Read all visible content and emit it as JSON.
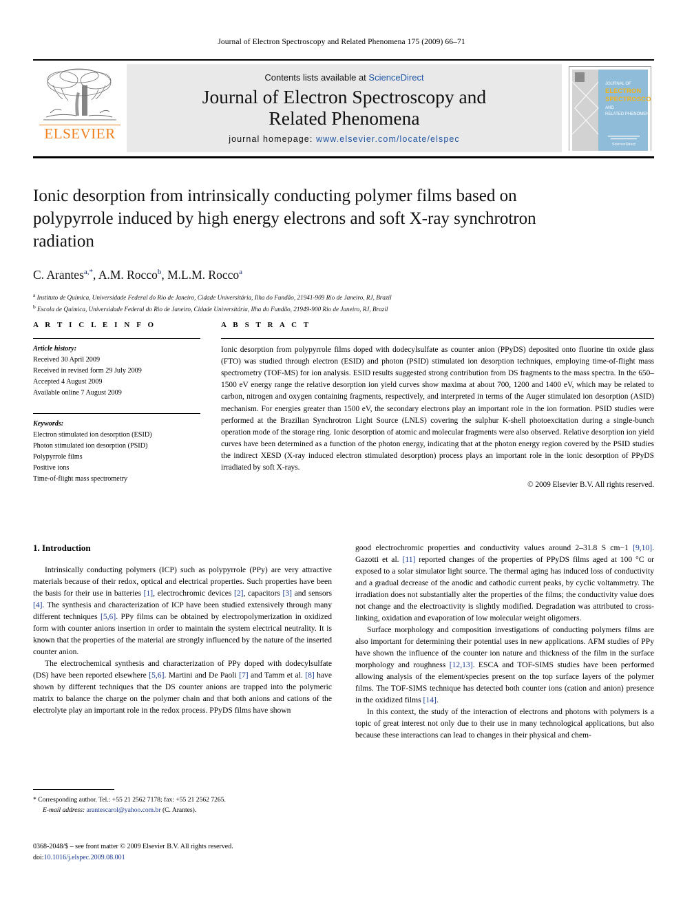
{
  "running_head": "Journal of Electron Spectroscopy and Related Phenomena 175 (2009) 66–71",
  "masthead": {
    "publisher": "ELSEVIER",
    "contents_prefix": "Contents lists available at ",
    "contents_link": "ScienceDirect",
    "journal_title_line1": "Journal of Electron Spectroscopy and",
    "journal_title_line2": "Related Phenomena",
    "homepage_label": "journal homepage:",
    "homepage_url": "www.elsevier.com/locate/elspec",
    "cover": {
      "line1": "JOURNAL OF",
      "line2": "ELECTRON",
      "line3": "SPECTROSCOPY",
      "line4": "AND",
      "line5": "RELATED PHENOMENA",
      "footer": "ScienceDirect",
      "accent_color": "#8fbcd9",
      "text_color": "#f0b41e"
    }
  },
  "article": {
    "title": "Ionic desorption from intrinsically conducting polymer films based on polypyrrole induced by high energy electrons and soft X-ray synchrotron radiation",
    "authors_html": "C. Arantes<sup>a,*</sup>, A.M. Rocco<sup>b</sup>, M.L.M. Rocco<sup>a</sup>",
    "affiliation_a": "Instituto de Química, Universidade Federal do Rio de Janeiro, Cidade Universitária, Ilha do Fundão, 21941-909 Rio de Janeiro, RJ, Brazil",
    "affiliation_b": "Escola de Química, Universidade Federal do Rio de Janeiro, Cidade Universitária, Ilha do Fundão, 21949-900 Rio de Janeiro, RJ, Brazil"
  },
  "article_info": {
    "heading": "A R T I C L E    I N F O",
    "history_label": "Article history:",
    "history": [
      "Received 30 April 2009",
      "Received in revised form 29 July 2009",
      "Accepted 4 August 2009",
      "Available online 7 August 2009"
    ],
    "keywords_label": "Keywords:",
    "keywords": [
      "Electron stimulated ion desorption (ESID)",
      "Photon stimulated ion desorption (PSID)",
      "Polypyrrole films",
      "Positive ions",
      "Time-of-flight mass spectrometry"
    ]
  },
  "abstract": {
    "heading": "A B S T R A C T",
    "text": "Ionic desorption from polypyrrole films doped with dodecylsulfate as counter anion (PPyDS) deposited onto fluorine tin oxide glass (FTO) was studied through electron (ESID) and photon (PSID) stimulated ion desorption techniques, employing time-of-flight mass spectrometry (TOF-MS) for ion analysis. ESID results suggested strong contribution from DS fragments to the mass spectra. In the 650–1500 eV energy range the relative desorption ion yield curves show maxima at about 700, 1200 and 1400 eV, which may be related to carbon, nitrogen and oxygen containing fragments, respectively, and interpreted in terms of the Auger stimulated ion desorption (ASID) mechanism. For energies greater than 1500 eV, the secondary electrons play an important role in the ion formation. PSID studies were performed at the Brazilian Synchrotron Light Source (LNLS) covering the sulphur K-shell photoexcitation during a single-bunch operation mode of the storage ring. Ionic desorption of atomic and molecular fragments were also observed. Relative desorption ion yield curves have been determined as a function of the photon energy, indicating that at the photon energy region covered by the PSID studies the indirect XESD (X-ray induced electron stimulated desorption) process plays an important role in the ionic desorption of PPyDS irradiated by soft X-rays.",
    "copyright": "© 2009 Elsevier B.V. All rights reserved."
  },
  "introduction": {
    "heading": "1. Introduction",
    "left_paragraphs": [
      "Intrinsically conducting polymers (ICP) such as polypyrrole (PPy) are very attractive materials because of their redox, optical and electrical properties. Such properties have been the basis for their use in batteries [1], electrochromic devices [2], capacitors [3] and sensors [4]. The synthesis and characterization of ICP have been studied extensively through many different techniques [5,6]. PPy films can be obtained by electropolymerization in oxidized form with counter anions insertion in order to maintain the system electrical neutrality. It is known that the properties of the material are strongly influenced by the nature of the inserted counter anion.",
      "The electrochemical synthesis and characterization of PPy doped with dodecylsulfate (DS) have been reported elsewhere [5,6]. Martini and De Paoli [7] and Tamm et al. [8] have shown by different techniques that the DS counter anions are trapped into the polymeric matrix to balance the charge on the polymer chain and that both anions and cations of the electrolyte play an important role in the redox process. PPyDS films have shown"
    ],
    "right_paragraphs": [
      "good electrochromic properties and conductivity values around 2–31.8 S cm−1 [9,10]. Gazotti et al. [11] reported changes of the properties of PPyDS films aged at 100 °C or exposed to a solar simulator light source. The thermal aging has induced loss of conductivity and a gradual decrease of the anodic and cathodic current peaks, by cyclic voltammetry. The irradiation does not substantially alter the properties of the films; the conductivity value does not change and the electroactivity is slightly modified. Degradation was attributed to cross-linking, oxidation and evaporation of low molecular weight oligomers.",
      "Surface morphology and composition investigations of conducting polymers films are also important for determining their potential uses in new applications. AFM studies of PPy have shown the influence of the counter ion nature and thickness of the film in the surface morphology and roughness [12,13]. ESCA and TOF-SIMS studies have been performed allowing analysis of the element/species present on the top surface layers of the polymer films. The TOF-SIMS technique has detected both counter ions (cation and anion) presence in the oxidized films [14].",
      "In this context, the study of the interaction of electrons and photons with polymers is a topic of great interest not only due to their use in many technological applications, but also because these interactions can lead to changes in their physical and chem-"
    ]
  },
  "footnote": {
    "marker": "*",
    "corresponding": "Corresponding author. Tel.: +55 21 2562 7178; fax: +55 21 2562 7265.",
    "email_label": "E-mail address:",
    "email": "arantescarol@yahoo.com.br",
    "email_suffix": "(C. Arantes)."
  },
  "imprint": {
    "issn_line": "0368-2048/$ – see front matter © 2009 Elsevier B.V. All rights reserved.",
    "doi_label": "doi:",
    "doi": "10.1016/j.elspec.2009.08.001"
  }
}
